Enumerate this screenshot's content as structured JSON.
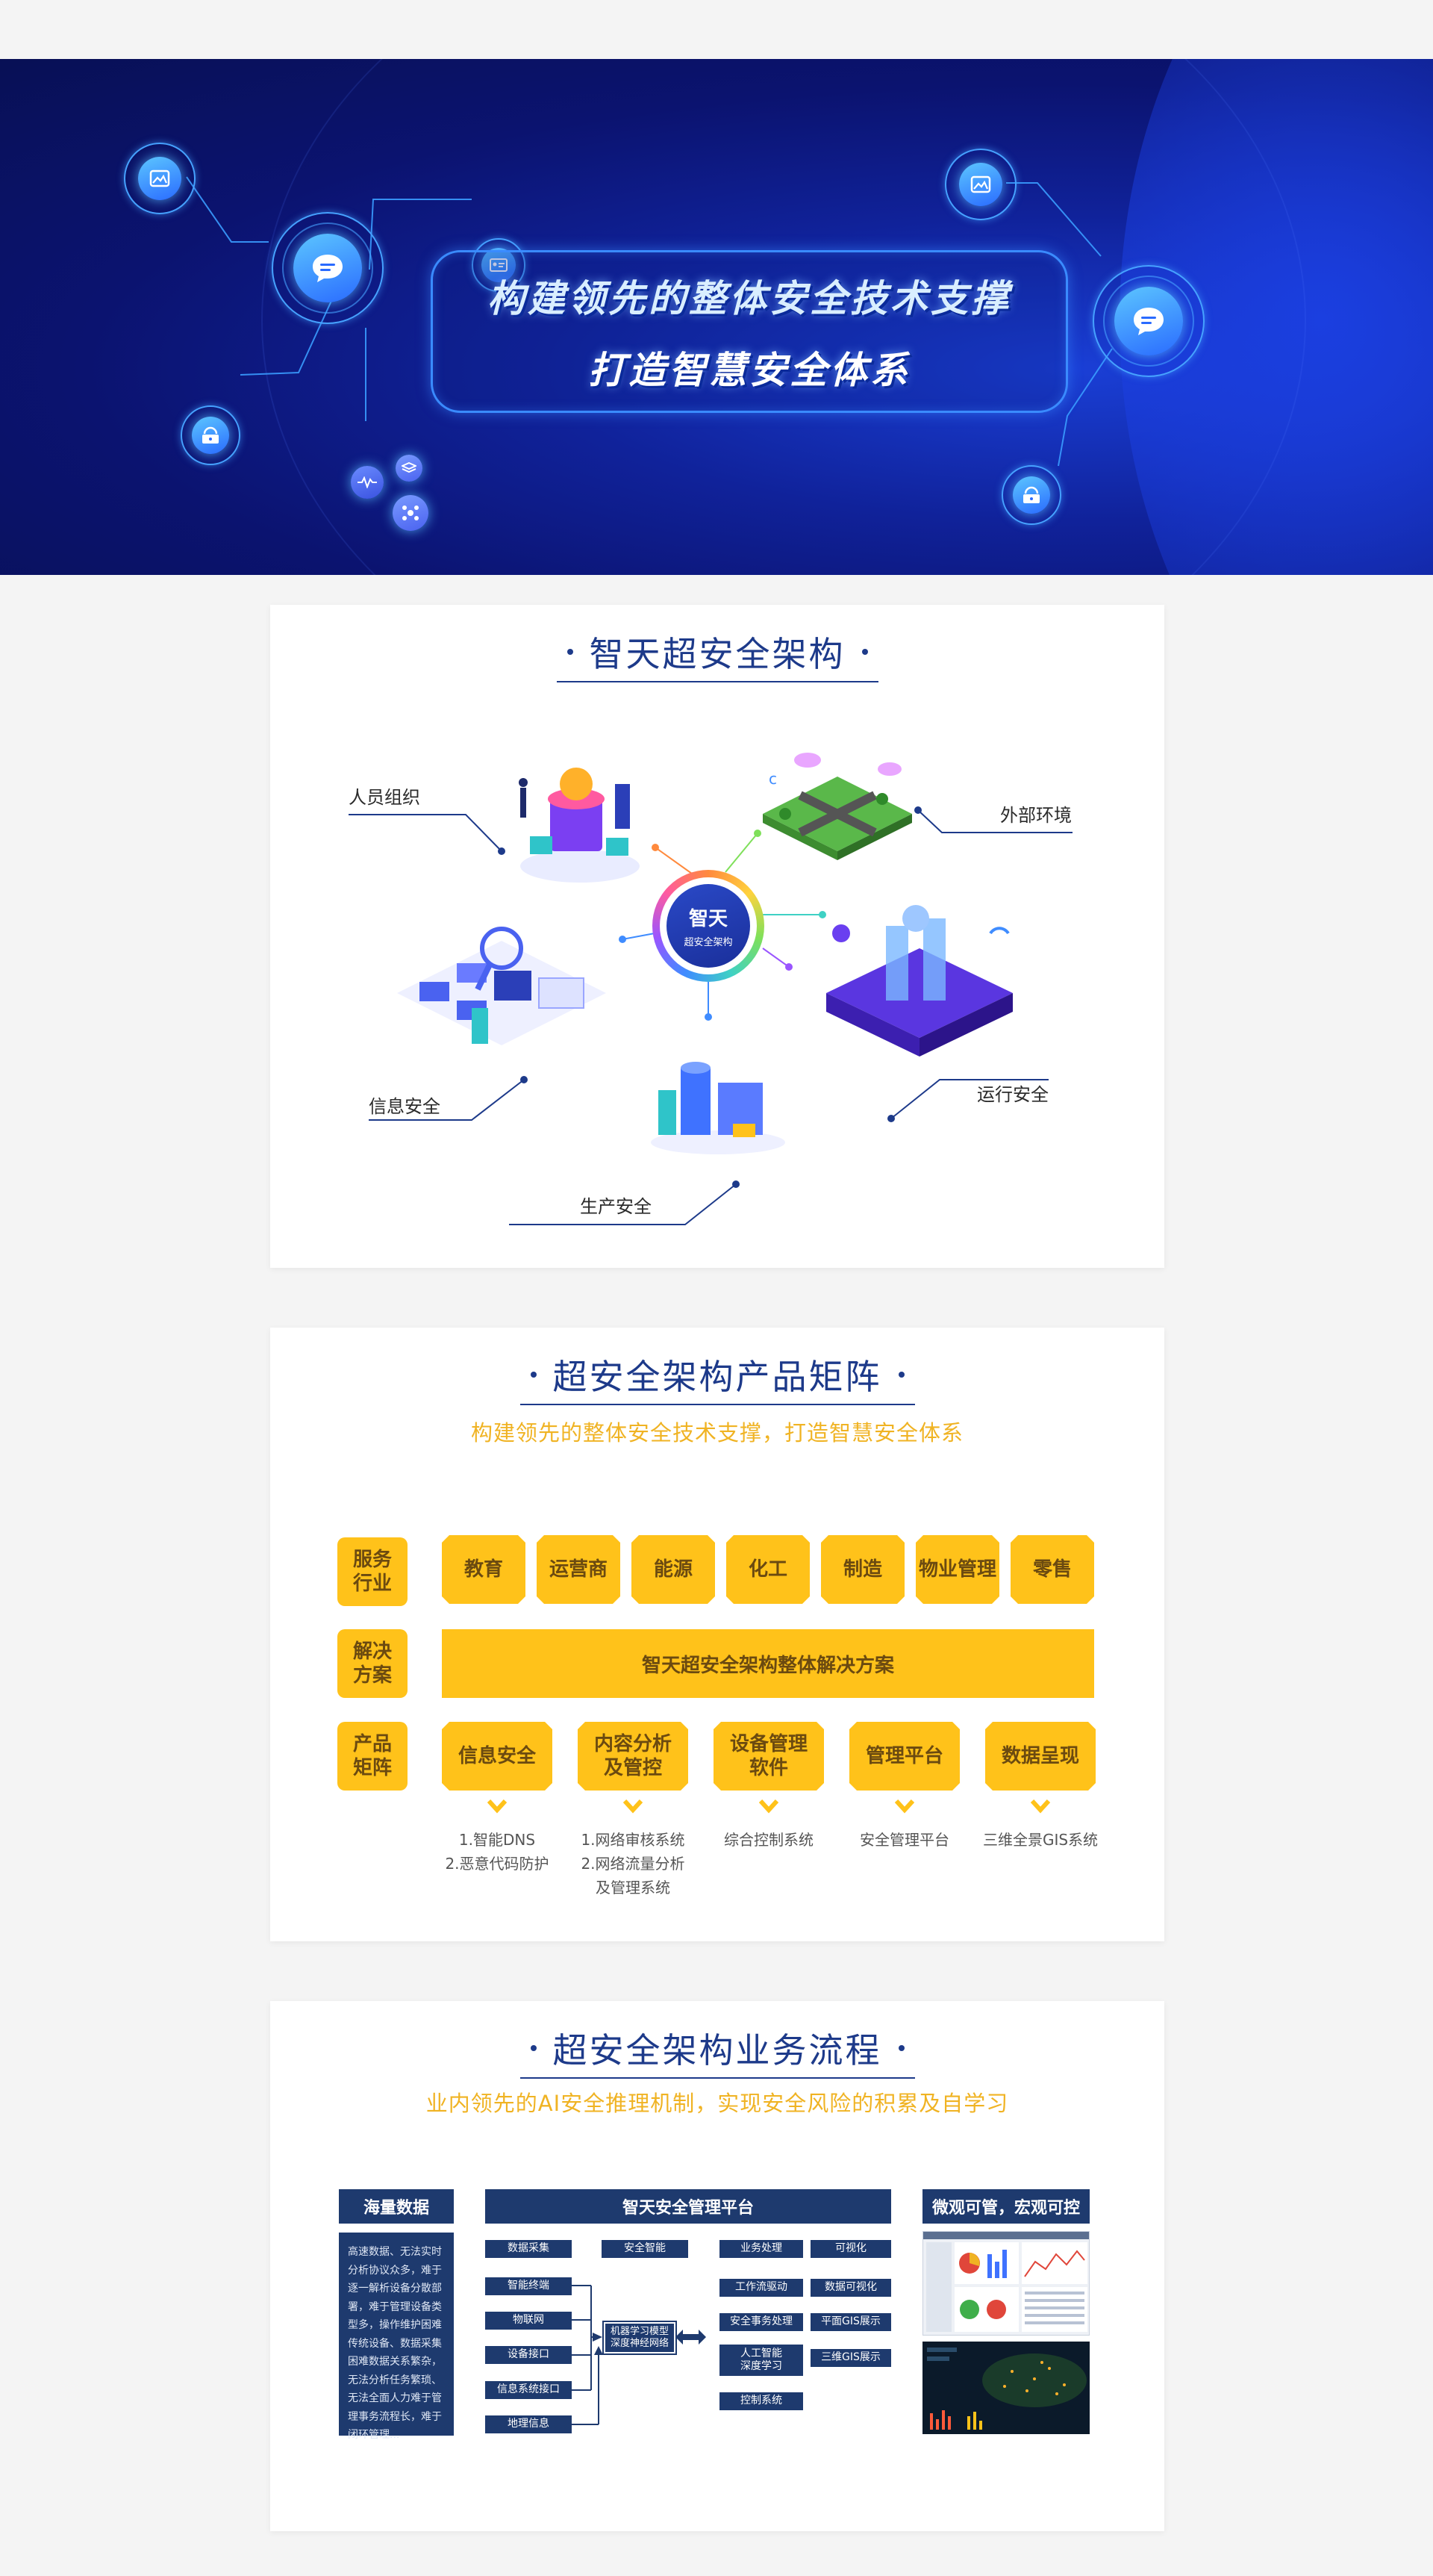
{
  "hero": {
    "title_line1": "构建领先的整体安全技术支撑",
    "title_line2": "打造智慧安全体系",
    "node_icons": [
      "image-icon",
      "chat-icon",
      "id-card-icon",
      "lock-icon",
      "waveform-icon",
      "layers-icon",
      "network-icon"
    ]
  },
  "architecture": {
    "title": "智天超安全架构",
    "center": {
      "title": "智天",
      "subtitle": "超安全架构"
    },
    "labels": {
      "people": "人员组织",
      "external": "外部环境",
      "info": "信息安全",
      "ops": "运行安全",
      "production": "生产安全"
    }
  },
  "matrix": {
    "title": "超安全架构产品矩阵",
    "subtitle": "构建领先的整体安全技术支撑，打造智慧安全体系",
    "row_labels": [
      "服务\n行业",
      "解决\n方案",
      "产品\n矩阵"
    ],
    "industries": [
      "教育",
      "运营商",
      "能源",
      "化工",
      "制造",
      "物业管理",
      "零售"
    ],
    "solution": "智天超安全架构整体解决方案",
    "products": [
      {
        "name": "信息安全",
        "desc": "1.智能DNS\n2.恶意代码防护"
      },
      {
        "name": "内容分析\n及管控",
        "desc": "1.网络审核系统\n2.网络流量分析\n及管理系统"
      },
      {
        "name": "设备管理\n软件",
        "desc": "综合控制系统"
      },
      {
        "name": "管理平台",
        "desc": "安全管理平台"
      },
      {
        "name": "数据呈现",
        "desc": "三维全景GIS系统"
      }
    ],
    "colors": {
      "accent": "#ffc21a",
      "text": "#6b4a10"
    }
  },
  "flow": {
    "title": "超安全架构业务流程",
    "subtitle": "业内领先的AI安全推理机制，实现安全风险的积累及自学习",
    "left_head": "海量数据",
    "left_text": "高速数据、无法实时分析协议众多，难于逐一解析设备分散部署，难于管理设备类型多，操作维护困难传统设备、数据采集困难数据关系繁杂，无法分析任务繁琐、无法全面人力难于管理事务流程长，难于闭环管理...",
    "mid_head": "智天安全管理平台",
    "right_head": "微观可管，宏观可控",
    "boxes": {
      "data_collect": "数据采集",
      "security_ai": "安全智能",
      "smart_terminal": "智能终端",
      "iot": "物联网",
      "device_interface": "设备接口",
      "info_system": "信息系统接口",
      "geo_info": "地理信息",
      "ml_model": "机器学习模型\n深度神经网络",
      "biz_process": "业务处理",
      "visualize": "可视化",
      "workflow": "工作流驱动",
      "data_visual": "数据可视化",
      "sec_event": "安全事务处理",
      "plane_gis": "平面GIS展示",
      "ai_deep": "人工智能\n深度学习",
      "gis3d": "三维GIS展示",
      "control_sys": "控制系统"
    },
    "colors": {
      "panel": "#1e3a6e"
    }
  },
  "colors": {
    "title_blue": "#1d3a8a",
    "subtitle_gold": "#f0b323",
    "page_bg": "#f4f4f4"
  }
}
